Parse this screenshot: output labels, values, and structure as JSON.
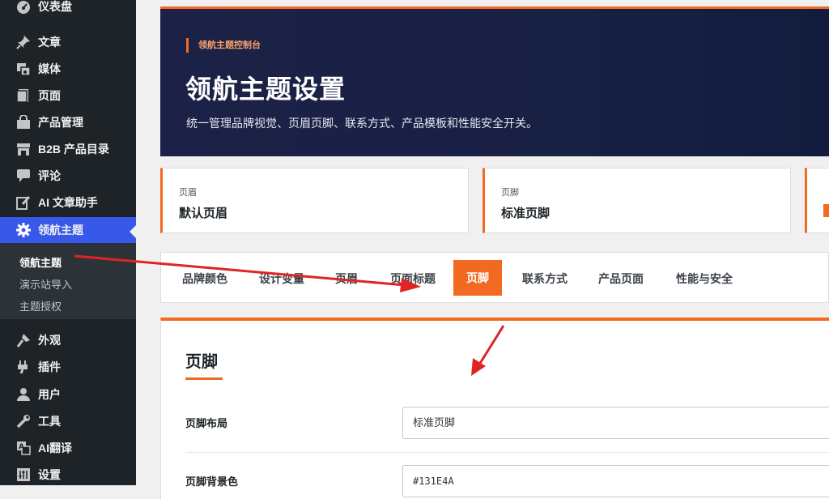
{
  "sidebar": {
    "items": [
      {
        "label": "仪表盘",
        "icon": "dashboard-icon"
      },
      {
        "label": "文章",
        "icon": "pin-icon"
      },
      {
        "label": "媒体",
        "icon": "media-icon"
      },
      {
        "label": "页面",
        "icon": "page-icon"
      },
      {
        "label": "产品管理",
        "icon": "bag-icon"
      },
      {
        "label": "B2B 产品目录",
        "icon": "store-icon"
      },
      {
        "label": "评论",
        "icon": "comment-icon"
      },
      {
        "label": "AI 文章助手",
        "icon": "edit-icon"
      },
      {
        "label": "领航主题",
        "icon": "gear-icon"
      },
      {
        "label": "外观",
        "icon": "brush-icon"
      },
      {
        "label": "插件",
        "icon": "plugin-icon"
      },
      {
        "label": "用户",
        "icon": "user-icon"
      },
      {
        "label": "工具",
        "icon": "wrench-icon"
      },
      {
        "label": "AI翻译",
        "icon": "translate-icon"
      },
      {
        "label": "设置",
        "icon": "settings-icon"
      }
    ],
    "submenu": [
      "领航主题",
      "演示站导入",
      "主题授权"
    ]
  },
  "hero": {
    "kicker": "领航主题控制台",
    "title": "领航主题设置",
    "subtitle": "统一管理品牌视觉、页眉页脚、联系方式、产品模板和性能安全开关。"
  },
  "cards": [
    {
      "key": "页眉",
      "value": "默认页眉"
    },
    {
      "key": "页脚",
      "value": "标准页脚"
    }
  ],
  "tabs": [
    "品牌颜色",
    "设计变量",
    "页眉",
    "页面标题",
    "页脚",
    "联系方式",
    "产品页面",
    "性能与安全"
  ],
  "panel": {
    "title": "页脚",
    "rows": [
      {
        "label": "页脚布局",
        "value": "标准页脚"
      },
      {
        "label": "页脚背景色",
        "value": "#131E4A"
      }
    ]
  },
  "colors": {
    "accent": "#f26a21",
    "hero_bg": "#1d2147",
    "sidebar_bg": "#1d2327",
    "active_menu": "#3858e9",
    "arrow": "#e02424"
  }
}
